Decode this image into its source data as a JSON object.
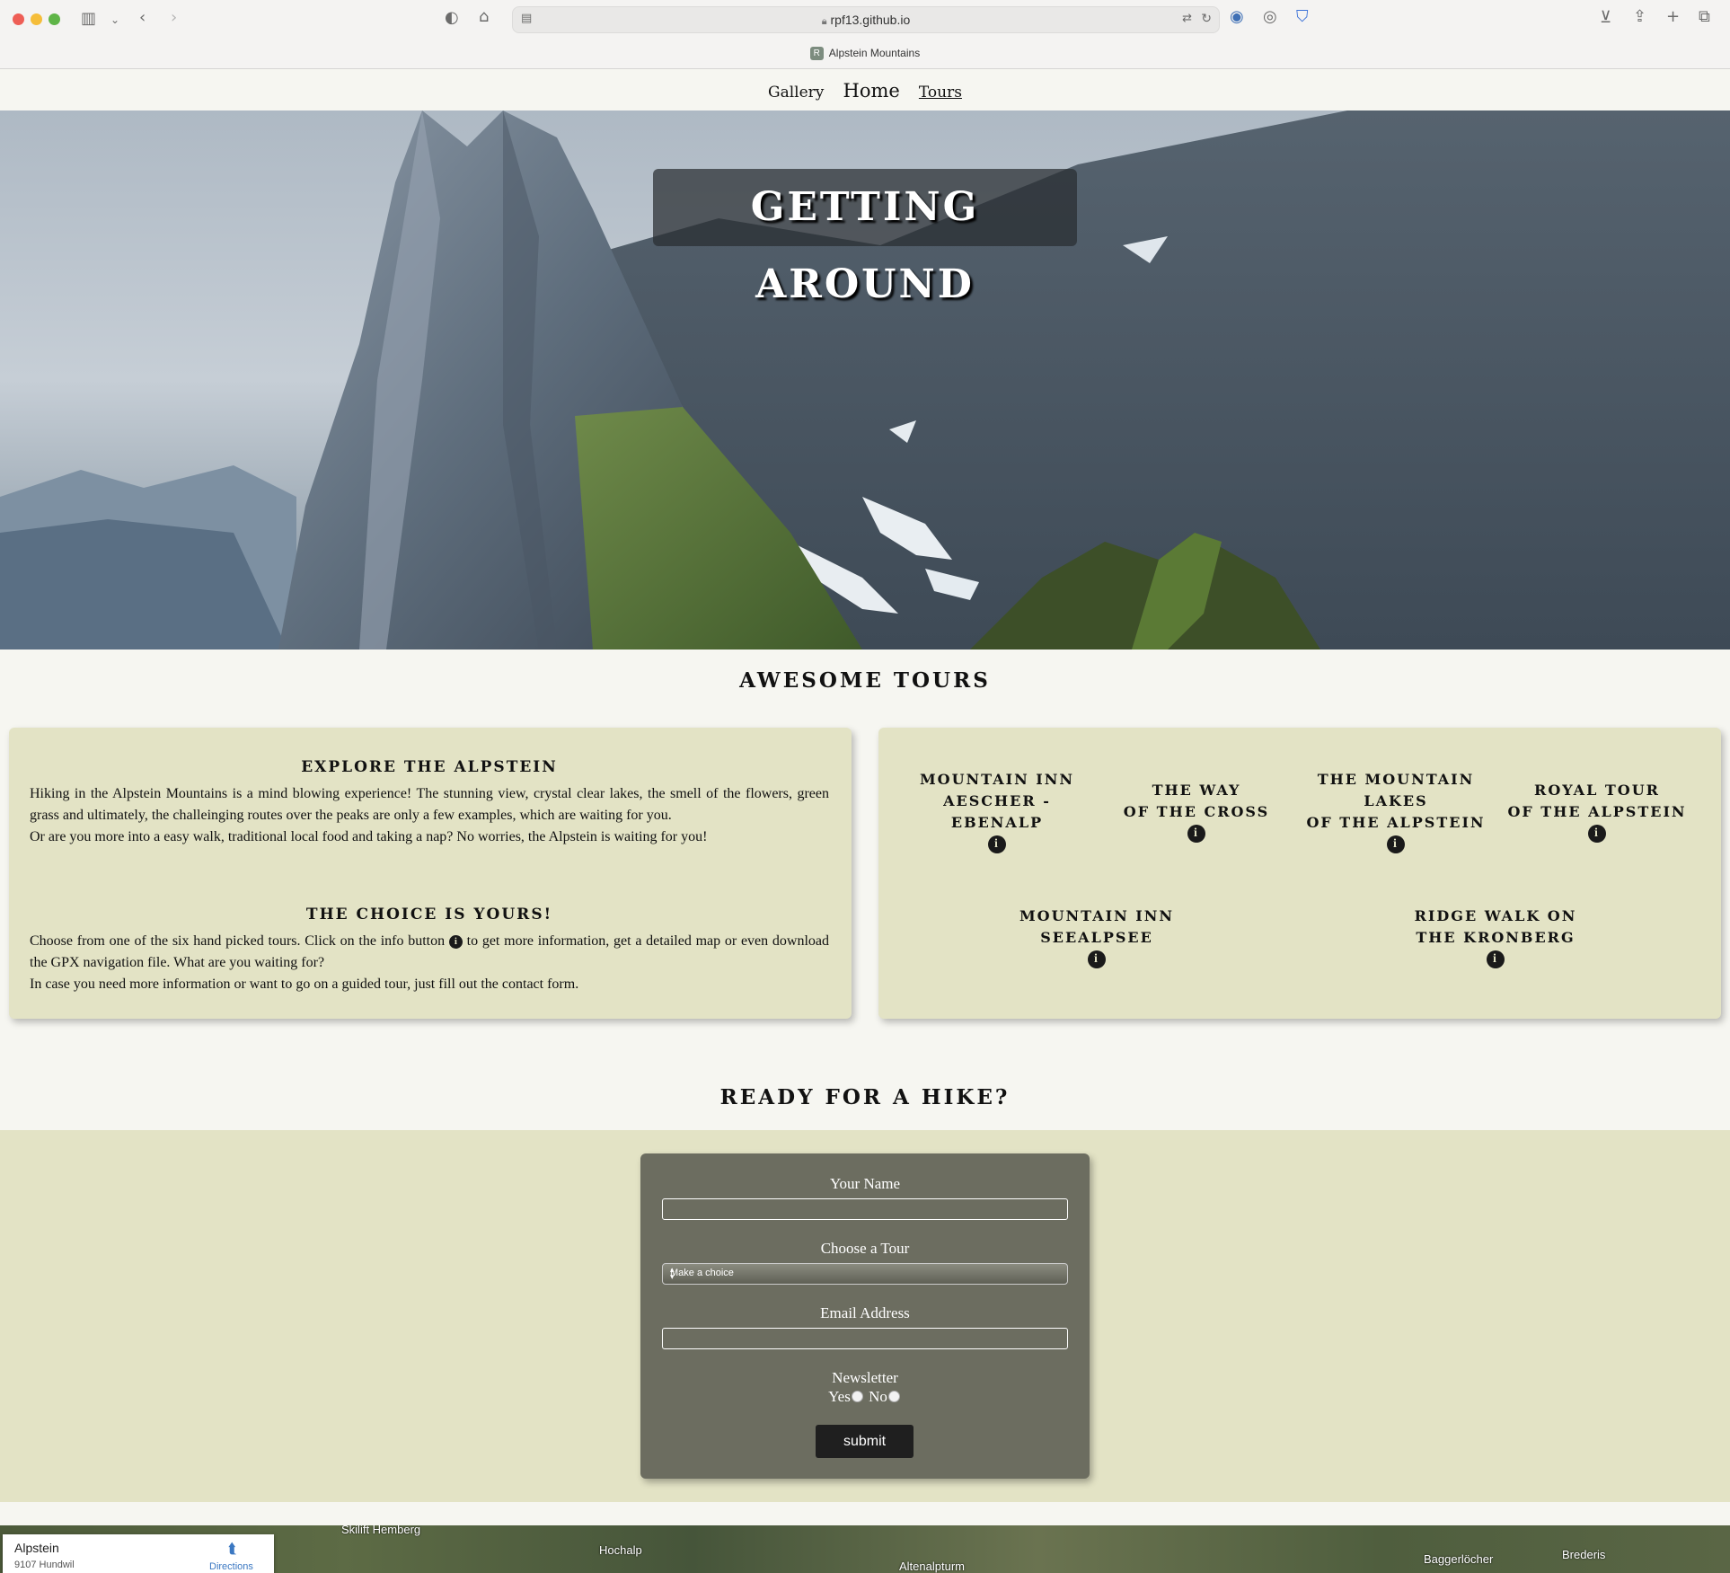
{
  "browser": {
    "url": "rpf13.github.io",
    "tab_title": "Alpstein Mountains",
    "tab_favicon_letter": "R"
  },
  "nav": {
    "gallery": "Gallery",
    "home": "Home",
    "tours": "Tours"
  },
  "hero": {
    "title": "GETTING AROUND"
  },
  "tours_section": {
    "title": "AWESOME TOURS",
    "explore_heading": "EXPLORE THE ALPSTEIN",
    "explore_p1": "Hiking in the Alpstein Mountains is a mind blowing experience! The stunning view, crystal clear lakes, the smell of the flowers, green grass and ultimately, the challeinging routes over the peaks are only a few examples, which are waiting for you.",
    "explore_p2": "Or are you more into a easy walk, traditional local food and taking a nap? No worries, the Alpstein is waiting for you!",
    "choice_heading": "THE CHOICE IS YOURS!",
    "choice_p1_a": "Choose from one of the six hand picked tours. Click on the info button",
    "choice_p1_b": "to get more information, get a detailed map or even download the GPX navigation file. What are you waiting for?",
    "choice_p2": "In case you need more information or want to go on a guided tour, just fill out the contact form.",
    "info_glyph": "i",
    "tours": [
      {
        "line1": "MOUNTAIN INN",
        "line2": "AESCHER -",
        "line3": "EBENALP"
      },
      {
        "line1": "THE WAY",
        "line2": "OF THE CROSS",
        "line3": ""
      },
      {
        "line1": "THE MOUNTAIN",
        "line2": "LAKES",
        "line3": "OF THE ALPSTEIN"
      },
      {
        "line1": "ROYAL TOUR",
        "line2": "OF THE ALPSTEIN",
        "line3": ""
      },
      {
        "line1": "MOUNTAIN INN",
        "line2": "SEEALPSEE",
        "line3": ""
      },
      {
        "line1": "RIDGE WALK ON",
        "line2": "THE KRONBERG",
        "line3": ""
      }
    ]
  },
  "form_section": {
    "title": "READY FOR A HIKE?",
    "name_label": "Your Name",
    "name_value": "",
    "tour_label": "Choose a Tour",
    "tour_selected": "Make a choice",
    "email_label": "Email Address",
    "email_value": "",
    "newsletter_label": "Newsletter",
    "yes_label": "Yes",
    "no_label": "No",
    "submit_label": "submit"
  },
  "map": {
    "place_name": "Alpstein",
    "place_address": "9107 Hundwil",
    "directions_label": "Directions",
    "labels": [
      "Skilift Hemberg",
      "Hochalp",
      "Altenalpturm",
      "Baggerlöcher",
      "Brederis"
    ]
  },
  "colors": {
    "page_bg": "#f6f6f1",
    "card_bg": "#e3e3c5",
    "form_bg": "#6c6d60",
    "button_bg": "#1f1f1f"
  }
}
